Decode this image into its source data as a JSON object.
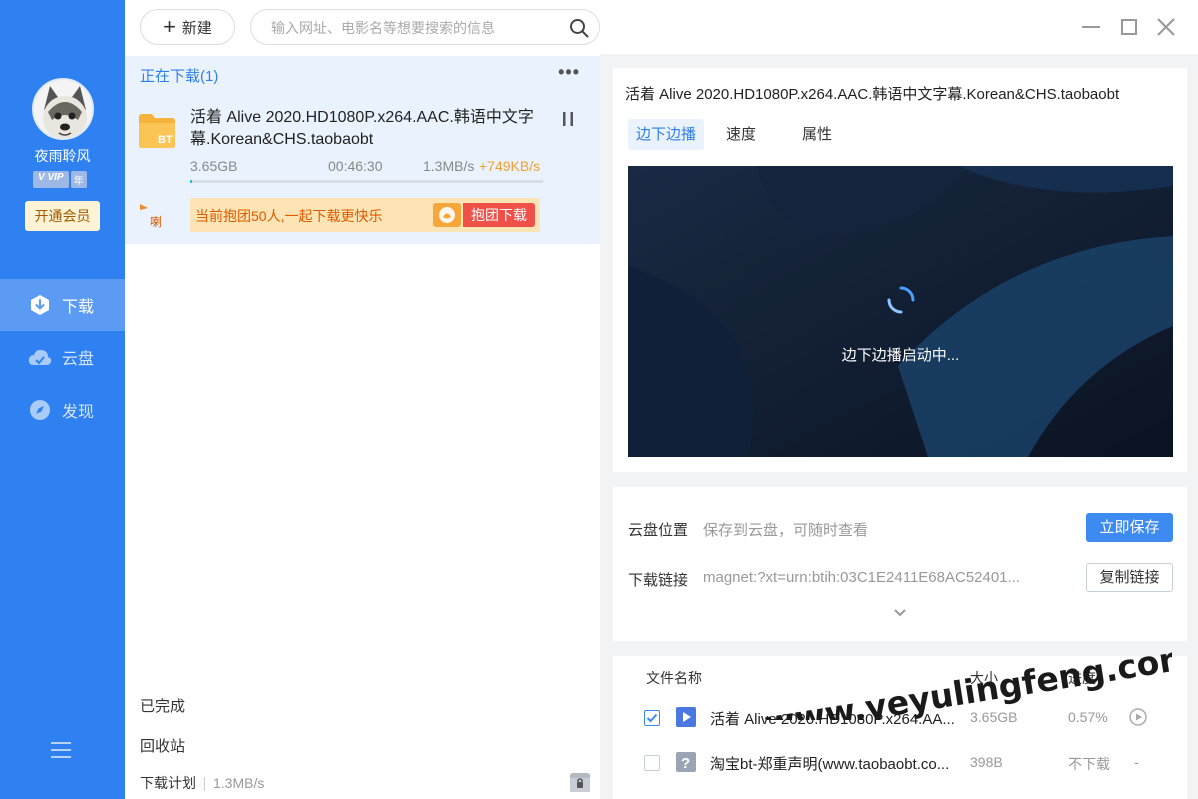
{
  "sidebar": {
    "user": {
      "name": "夜雨聆风",
      "vip_badge": "VIP",
      "year_badge": "年"
    },
    "open_vip_label": "开通会员",
    "items": [
      {
        "label": "下载",
        "icon": "download-icon"
      },
      {
        "label": "云盘",
        "icon": "cloud-icon"
      },
      {
        "label": "发现",
        "icon": "compass-icon"
      }
    ]
  },
  "topbar": {
    "new_label": "新建",
    "search_placeholder": "输入网址、电影名等想要搜索的信息"
  },
  "downloads": {
    "section_title": "正在下载(1)",
    "task": {
      "name": "活着 Alive 2020.HD1080P.x264.AAC.韩语中文字幕.Korean&CHS.taobaobt",
      "file_badge": "BT",
      "size": "3.65GB",
      "time_left": "00:46:30",
      "speed": "1.3MB/s",
      "boost": "+749KB/s",
      "progress": 0.0057,
      "promo_text": "当前抱团50人,一起下载更快乐",
      "promo_button": "抱团下载"
    },
    "completed_label": "已完成",
    "recycle_label": "回收站",
    "plan_label": "下载计划",
    "plan_speed": "1.3MB/s"
  },
  "detail": {
    "title": "活着 Alive 2020.HD1080P.x264.AAC.韩语中文字幕.Korean&CHS.taobaobt",
    "tabs": [
      "边下边播",
      "速度",
      "属性"
    ],
    "player_status": "边下边播启动中...",
    "cloud": {
      "label": "云盘位置",
      "value": "保存到云盘，可随时查看",
      "save_button": "立即保存"
    },
    "link": {
      "label": "下载链接",
      "value": "magnet:?xt=urn:btih:03C1E2411E68AC52401...",
      "copy_button": "复制链接"
    }
  },
  "files": {
    "headers": {
      "name": "文件名称",
      "size": "大小",
      "progress": "进度"
    },
    "rows": [
      {
        "name": "活着 Alive 2020.HD1080P.x264.AA...",
        "size": "3.65GB",
        "progress": "0.57%",
        "checked": true,
        "type": "video-icon"
      },
      {
        "name": "淘宝bt-郑重声明(www.taobaobt.co...",
        "size": "398B",
        "progress": "不下载",
        "extra": "-",
        "checked": false,
        "type": "unknown-file-icon"
      }
    ]
  },
  "watermark": "www.yeyulingfeng.com",
  "colors": {
    "sidebar": "#2f80f0",
    "accent": "#2f7fe8",
    "boost": "#f0a030",
    "promo_button": "#ef5048",
    "save_button": "#3d8af0"
  }
}
